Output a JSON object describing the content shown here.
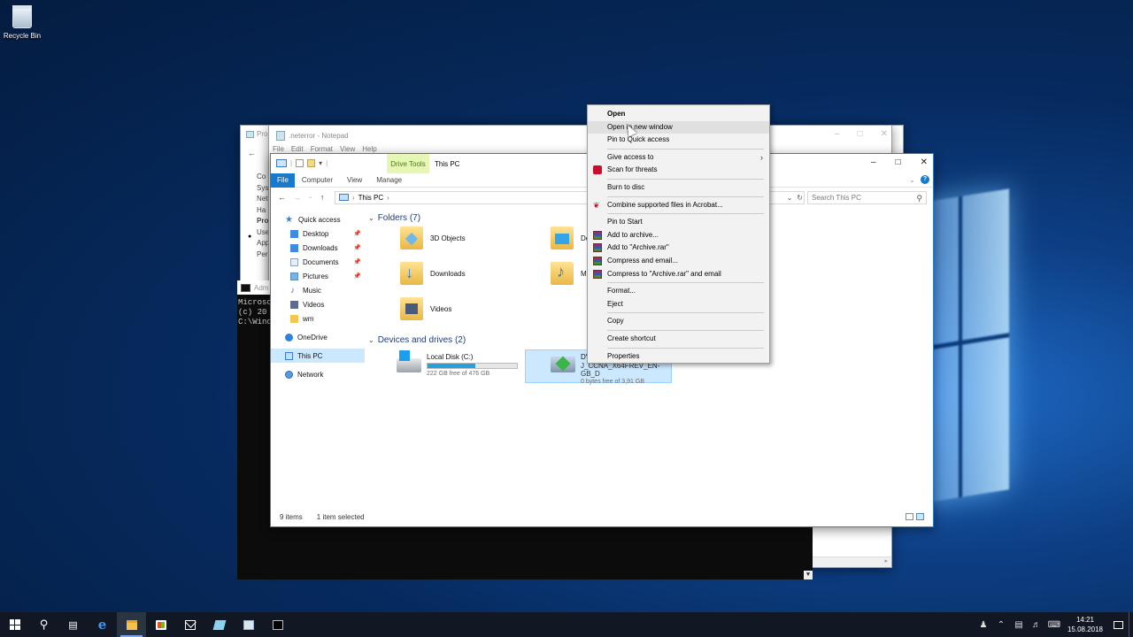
{
  "desktop": {
    "icons": [
      {
        "label": "Recycle Bin",
        "icon": "recycle-bin-icon"
      }
    ]
  },
  "programs_window": {
    "title": "Pro",
    "side_lines": [
      "Co",
      "Sys",
      "Net",
      "Ha",
      "Pro",
      "Use",
      "App",
      "Per"
    ]
  },
  "notepad": {
    "title": ".neterror - Notepad",
    "menu": [
      "File",
      "Edit",
      "Format",
      "View",
      "Help"
    ]
  },
  "cmd": {
    "title": "Adm",
    "lines": [
      "Microso",
      "(c) 20",
      "",
      "C:\\Wind"
    ]
  },
  "explorer": {
    "drive_tools_label": "Drive Tools",
    "window_title": "This PC",
    "ribbon_tabs": [
      "File",
      "Computer",
      "View",
      "Manage"
    ],
    "address_path": "This PC",
    "search_placeholder": "Search This PC",
    "nav": [
      {
        "label": "Quick access",
        "icon": "star-icon"
      },
      {
        "label": "Desktop",
        "icon": "desktop-icon",
        "pinned": true
      },
      {
        "label": "Downloads",
        "icon": "downloads-icon",
        "pinned": true
      },
      {
        "label": "Documents",
        "icon": "documents-icon",
        "pinned": true
      },
      {
        "label": "Pictures",
        "icon": "pictures-icon",
        "pinned": true
      },
      {
        "label": "Music",
        "icon": "music-icon"
      },
      {
        "label": "Videos",
        "icon": "videos-icon"
      },
      {
        "label": "wm",
        "icon": "folder-icon"
      },
      {
        "label": "OneDrive",
        "icon": "onedrive-icon"
      },
      {
        "label": "This PC",
        "icon": "this-pc-icon",
        "selected": true
      },
      {
        "label": "Network",
        "icon": "network-icon"
      }
    ],
    "folders_header": "Folders (7)",
    "folders": [
      {
        "label": "3D Objects",
        "icon": "3d-objects-folder-icon"
      },
      {
        "label": "De",
        "icon": "desktop-folder-icon"
      },
      {
        "label": "Downloads",
        "icon": "downloads-folder-icon"
      },
      {
        "label": "Mu",
        "icon": "music-folder-icon"
      },
      {
        "label": "Videos",
        "icon": "videos-folder-icon"
      }
    ],
    "devices_header": "Devices and drives (2)",
    "drives": [
      {
        "name": "Local Disk (C:)",
        "free": "222 GB free of 476 GB",
        "used_fraction": 0.53,
        "icon": "hard-disk-icon"
      },
      {
        "name": "DV",
        "name_line2": "J_CCNA_X64FREV_EN-GB_D",
        "free": "0 bytes free of 3,91 GB",
        "icon": "dvd-drive-icon",
        "selected": true
      }
    ],
    "status": {
      "items": "9 items",
      "selected": "1 item selected"
    }
  },
  "context_menu": {
    "items": [
      {
        "label": "Open",
        "bold": true
      },
      {
        "label": "Open in new window",
        "hover": true
      },
      {
        "label": "Pin to Quick access"
      },
      {
        "sep": true
      },
      {
        "label": "Give access to",
        "submenu": true
      },
      {
        "label": "Scan for threats",
        "icon": "defender-shield-icon"
      },
      {
        "sep": true
      },
      {
        "label": "Burn to disc"
      },
      {
        "sep": true
      },
      {
        "label": "Combine supported files in Acrobat...",
        "icon": "acrobat-icon"
      },
      {
        "sep": true
      },
      {
        "label": "Pin to Start"
      },
      {
        "label": "Add to archive...",
        "icon": "winrar-icon"
      },
      {
        "label": "Add to \"Archive.rar\"",
        "icon": "winrar-icon"
      },
      {
        "label": "Compress and email...",
        "icon": "winrar-icon"
      },
      {
        "label": "Compress to \"Archive.rar\" and email",
        "icon": "winrar-icon"
      },
      {
        "sep": true
      },
      {
        "label": "Format..."
      },
      {
        "label": "Eject"
      },
      {
        "sep": true
      },
      {
        "label": "Copy"
      },
      {
        "sep": true
      },
      {
        "label": "Create shortcut"
      },
      {
        "sep": true
      },
      {
        "label": "Properties"
      }
    ]
  },
  "taskbar": {
    "time": "14:21",
    "date": "15.08.2018"
  }
}
